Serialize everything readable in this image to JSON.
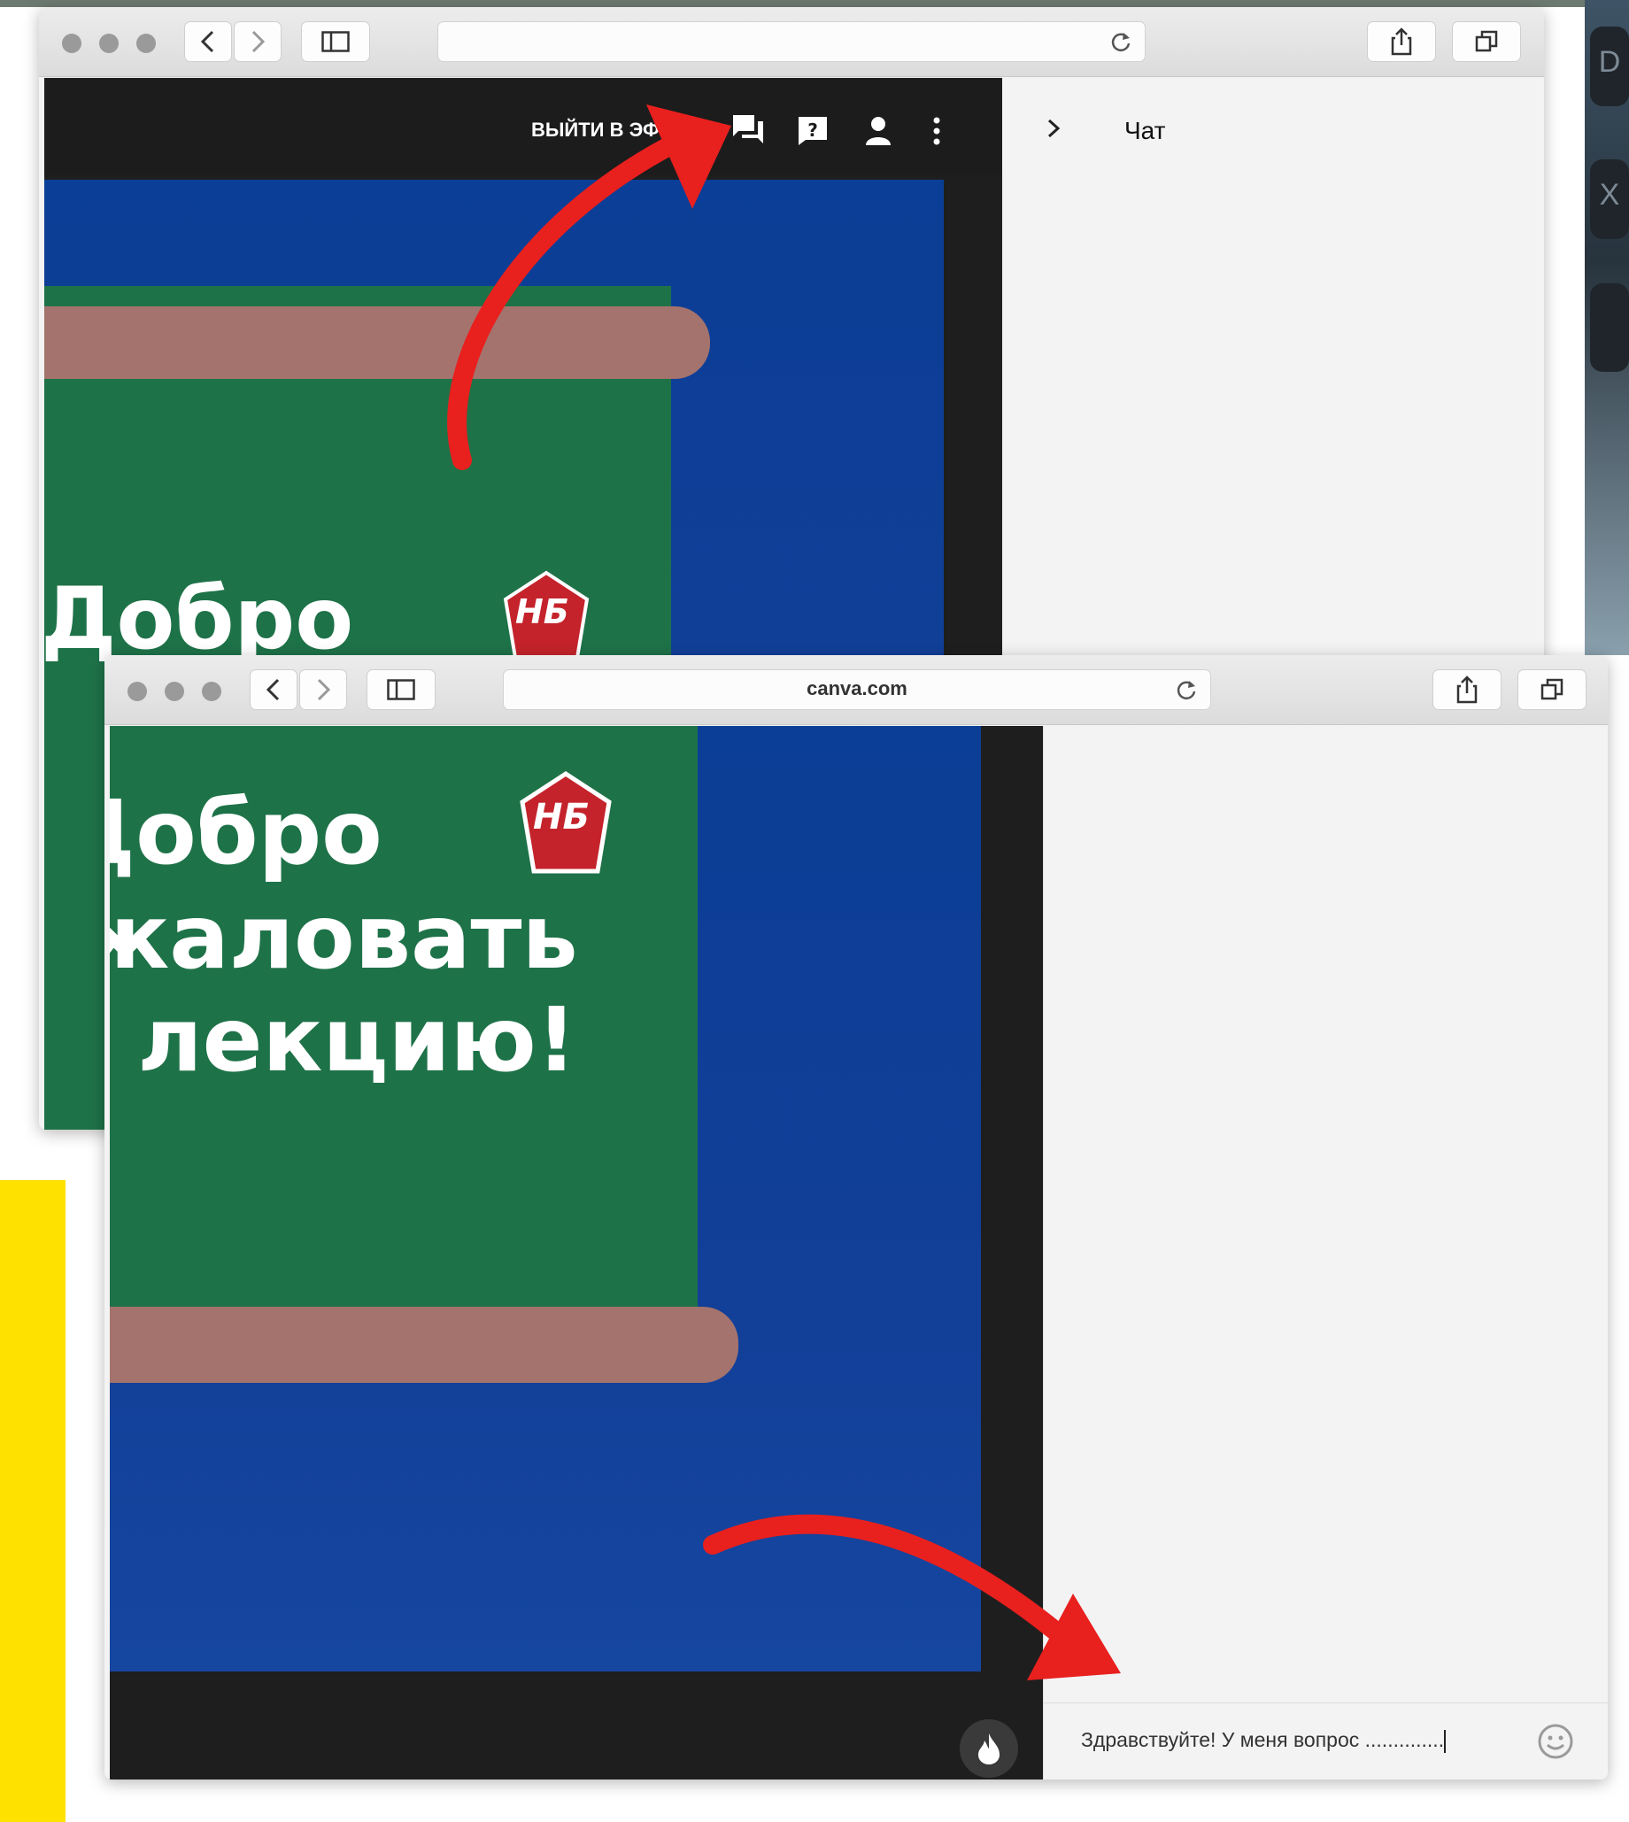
{
  "top_window": {
    "url": "",
    "toolbar": {
      "go_live_label": "ВЫЙТИ В ЭФИР",
      "icons": [
        "chat-icon",
        "question-icon",
        "person-icon",
        "more-vert-icon"
      ]
    },
    "chat_panel": {
      "collapse_icon": "chevron-right-icon",
      "title": "Чат"
    },
    "slide_text": [
      "Добро"
    ],
    "logo_text": "НБ"
  },
  "bottom_window": {
    "url": "canva.com",
    "slide_text": [
      "Добро",
      "пожаловать",
      "на лекцию!"
    ],
    "logo_text": "НБ",
    "chat_input": {
      "value": "Здравствуйте! У меня вопрос ..............",
      "emoji_icon": "smiley-icon"
    },
    "reaction_icon": "flame-icon"
  },
  "annotations": {
    "arrow_color": "#e8201e"
  },
  "background": {
    "keyboard_keys": [
      "D",
      "X"
    ]
  }
}
